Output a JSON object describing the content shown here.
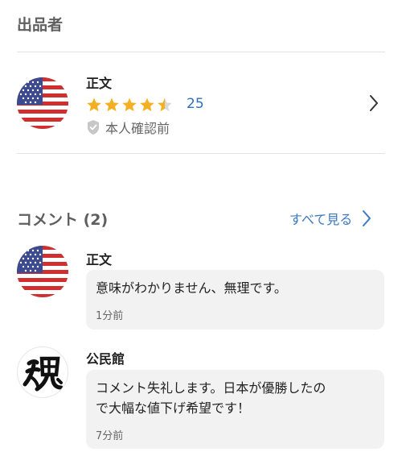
{
  "seller": {
    "section_title": "出品者",
    "name": "正文",
    "rating": 4.5,
    "review_count": "25",
    "verification_status": "本人確認前",
    "star_color": "#f5b021",
    "avatar_icon": "us-flag-icon"
  },
  "comments": {
    "section_title": "コメント (2)",
    "see_all_label": "すべて見る",
    "items": [
      {
        "author": "正文",
        "avatar_icon": "us-flag-icon",
        "text": "意味がわかりません、無理です。",
        "time": "1分前"
      },
      {
        "author": "公民館",
        "avatar_icon": "tamashii-calligraphy-icon",
        "text": "コメント失礼します。日本が優勝したの\nで大幅な値下げ希望です！",
        "time": "7分前"
      }
    ]
  },
  "colors": {
    "accent_blue": "#3a78c3",
    "bubble_bg": "#f2f2f2",
    "divider": "#e3e3e3"
  }
}
